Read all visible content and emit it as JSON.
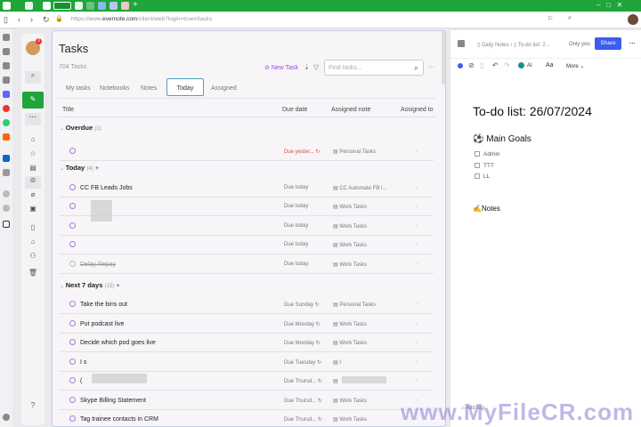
{
  "browser": {
    "url_prefix": "https://www.",
    "url_domain": "evernote.com",
    "url_path": "/client/web?login=true#/tasks"
  },
  "sidebar": {
    "notification_count": "3"
  },
  "tasks": {
    "title": "Tasks",
    "count": "704 Tasks",
    "new_task": "New Task",
    "search_placeholder": "Find tasks...",
    "tabs": [
      "My tasks",
      "Notebooks",
      "Notes",
      "Today",
      "Assigned"
    ],
    "active_tab": "Today",
    "columns": [
      "Title",
      "Due date",
      "Assigned note",
      "Assigned to"
    ],
    "groups": [
      {
        "name": "Overdue",
        "count": "(1)",
        "rows": [
          {
            "title": "",
            "due": "Due yester...",
            "note": "Personal Tasks",
            "assigned": "-"
          }
        ]
      },
      {
        "name": "Today",
        "count": "(4)",
        "rows": [
          {
            "title": "CC FB Leads Jobs",
            "due": "Due today",
            "note": "CC Automate FB l...",
            "assigned": "-"
          },
          {
            "title": "",
            "due": "Due today",
            "note": "Work Tasks",
            "assigned": "-"
          },
          {
            "title": "",
            "due": "Due today",
            "note": "Work Tasks",
            "assigned": "-"
          },
          {
            "title": "",
            "due": "Due today",
            "note": "Work Tasks",
            "assigned": "-"
          },
          {
            "title": "Delay Repay",
            "due": "Due today",
            "note": "Work Tasks",
            "assigned": "-",
            "done": true
          }
        ]
      },
      {
        "name": "Next 7 days",
        "count": "(15)",
        "rows": [
          {
            "title": "Take the bins out",
            "due": "Due Sunday",
            "note": "Personal Tasks",
            "assigned": "-"
          },
          {
            "title": "Put podcast live",
            "due": "Due Monday",
            "note": "Work Tasks",
            "assigned": "-"
          },
          {
            "title": "Decide which pod goes live",
            "due": "Due Monday",
            "note": "Work Tasks",
            "assigned": "-"
          },
          {
            "title": "I                        s",
            "due": "Due Tuesday",
            "note": "I",
            "assigned": "-"
          },
          {
            "title": "(",
            "due": "Due Thursd...",
            "note": "",
            "assigned": "-"
          },
          {
            "title": "Skype Billing Statement",
            "due": "Due Thursd...",
            "note": "Work Tasks",
            "assigned": "-"
          },
          {
            "title": "Tag trainee contacts in CRM",
            "due": "Due Thursd...",
            "note": "Work Tasks",
            "assigned": "-"
          }
        ]
      }
    ]
  },
  "note": {
    "breadcrumb_notebook": "Daily Notes",
    "breadcrumb_note": "To-do list: 2...",
    "visibility": "Only you",
    "share": "Share",
    "ai": "AI",
    "font": "Aa",
    "more": "More",
    "title": "To-do list: 26/07/2024",
    "heading": "Main Goals",
    "checklist": [
      "Admin",
      "TTT",
      "LL"
    ],
    "notes_heading": "Notes",
    "add_tag": "Add tag"
  },
  "watermark": "www.MyFileCR.com",
  "colors": {
    "brand": "#1fa53a",
    "accent": "#a64bd6",
    "share": "#3b5ef0",
    "overdue": "#e0483e"
  }
}
